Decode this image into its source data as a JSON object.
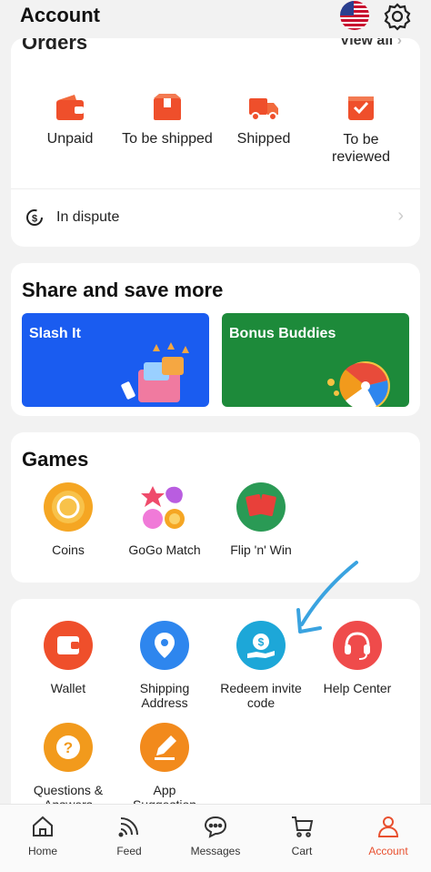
{
  "header": {
    "title": "Account"
  },
  "orders": {
    "title": "Orders",
    "view_all": "View all",
    "items": [
      {
        "label": "Unpaid",
        "icon": "wallet-icon"
      },
      {
        "label": "To be shipped",
        "icon": "box-icon"
      },
      {
        "label": "Shipped",
        "icon": "truck-icon"
      },
      {
        "label_line1": "To be",
        "label_line2": "reviewed",
        "icon": "review-icon"
      }
    ],
    "dispute": "In dispute"
  },
  "share": {
    "title": "Share and save more",
    "cards": [
      {
        "label": "Slash It",
        "color": "#1a5cf0"
      },
      {
        "label": "Bonus Buddies",
        "color": "#1d8a3a"
      }
    ]
  },
  "games": {
    "title": "Games",
    "items": [
      {
        "label": "Coins",
        "icon": "coins-icon"
      },
      {
        "label": "GoGo Match",
        "icon": "gogo-match-icon"
      },
      {
        "label": "Flip 'n' Win",
        "icon": "flip-cards-icon"
      }
    ]
  },
  "services": {
    "items": [
      {
        "line1": "Wallet",
        "line2": "",
        "color": "#ef4f2b",
        "icon": "wallet-icon"
      },
      {
        "line1": "Shipping",
        "line2": "Address",
        "color": "#2e86ee",
        "icon": "location-pin-icon"
      },
      {
        "line1": "Redeem invite",
        "line2": "code",
        "color": "#1da7d8",
        "icon": "redeem-coin-icon"
      },
      {
        "line1": "Help Center",
        "line2": "",
        "color": "#ef4b4b",
        "icon": "headset-icon"
      },
      {
        "line1": "Questions &",
        "line2": "Answers",
        "color": "#f29a1c",
        "icon": "question-icon"
      },
      {
        "line1": "App",
        "line2": "Suggestion",
        "color": "#f28a1c",
        "icon": "pen-icon"
      }
    ]
  },
  "nav": [
    {
      "label": "Home",
      "icon": "home-icon"
    },
    {
      "label": "Feed",
      "icon": "feed-icon"
    },
    {
      "label": "Messages",
      "icon": "chat-icon"
    },
    {
      "label": "Cart",
      "icon": "cart-icon"
    },
    {
      "label": "Account",
      "icon": "user-icon",
      "active": true
    }
  ],
  "colors": {
    "accent": "#e8502f",
    "arrow": "#3aa3e0"
  }
}
